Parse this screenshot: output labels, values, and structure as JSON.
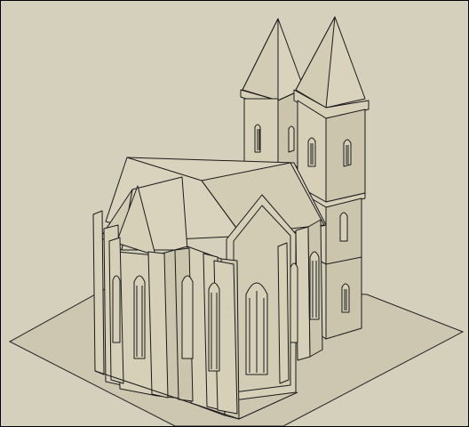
{
  "scene": {
    "model": "gothic-church-3d-model",
    "colors": {
      "sky": "#d5d0bc",
      "ground": "#cdc7b1",
      "wall": "#d6d0b8",
      "roof": "#d9d3bd",
      "shadow": "#bfb9a2",
      "line": "#1a1a1a"
    }
  }
}
